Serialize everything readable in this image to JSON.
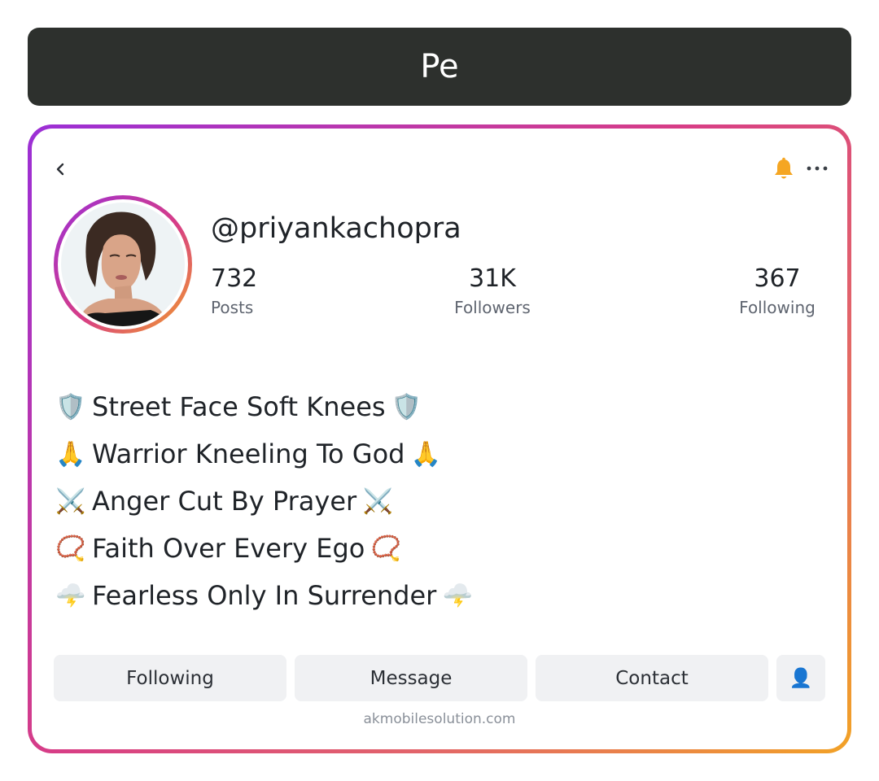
{
  "header": {
    "title": "Pe"
  },
  "profile": {
    "username": "@priyankachopra",
    "stats": {
      "posts": {
        "value": "732",
        "label": "Posts"
      },
      "followers": {
        "value": "31K",
        "label": "Followers"
      },
      "following": {
        "value": "367",
        "label": "Following"
      }
    }
  },
  "bio": [
    {
      "text": "Street Face Soft Knees",
      "emoji": "🛡️"
    },
    {
      "text": "Warrior Kneeling To God",
      "emoji": "🙏"
    },
    {
      "text": "Anger Cut By Prayer",
      "emoji": "⚔️"
    },
    {
      "text": "Faith Over Every Ego",
      "emoji": "📿"
    },
    {
      "text": "Fearless Only In Surrender",
      "emoji": "🌩️"
    }
  ],
  "actions": {
    "following_label": "Following",
    "message_label": "Message",
    "contact_label": "Contact",
    "user_icon": "👤"
  },
  "footer": {
    "url": "akmobilesolution.com"
  },
  "icons": {
    "back": "chevron-left-icon",
    "notifications": "bell-icon",
    "more": "more-horizontal-icon"
  },
  "colors": {
    "title_bar": "#2d302d",
    "gradient_start": "#9b2fd6",
    "gradient_mid": "#d73d86",
    "gradient_end": "#f2a226",
    "bell": "#f5a623",
    "button_bg": "#f0f1f3"
  }
}
